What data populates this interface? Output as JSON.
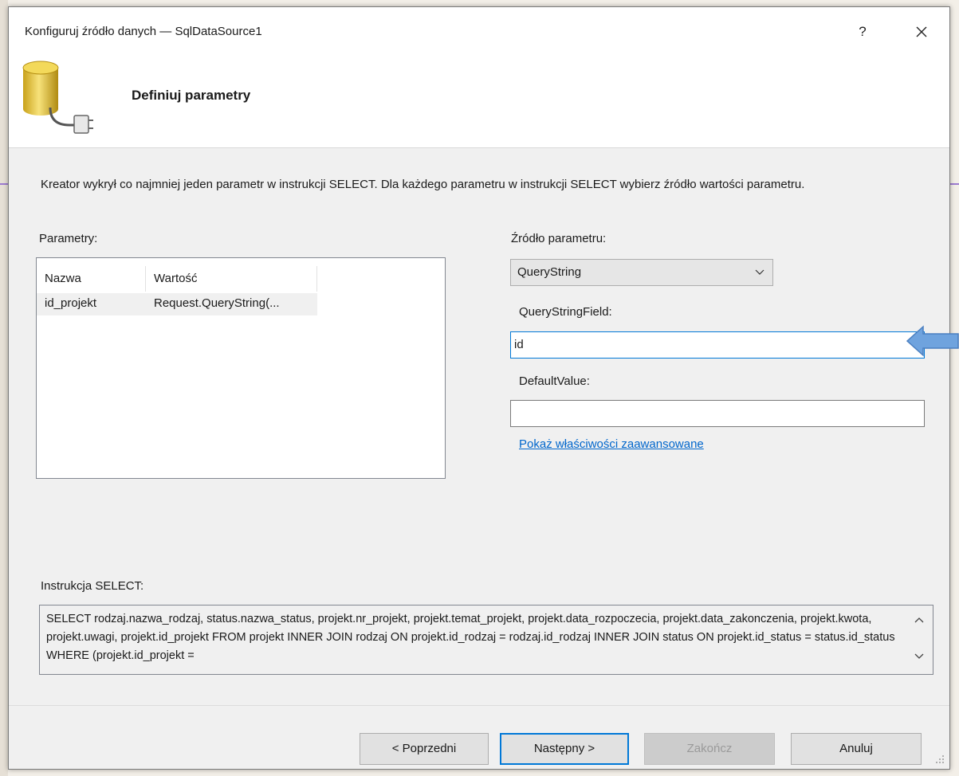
{
  "window": {
    "title": "Konfiguruj źródło danych — SqlDataSource1",
    "help_label": "?",
    "close_icon": "close-icon"
  },
  "header": {
    "title": "Definiuj parametry",
    "icon": "database-connector-icon"
  },
  "intro_text": "Kreator wykrył co najmniej jeden parametr w instrukcji SELECT. Dla każdego parametru w instrukcji SELECT wybierz źródło wartości parametru.",
  "parameters": {
    "label": "Parametry:",
    "columns": [
      "Nazwa",
      "Wartość"
    ],
    "rows": [
      [
        "id_projekt",
        "Request.QueryString(..."
      ]
    ]
  },
  "source": {
    "label": "Źródło parametru:",
    "selected": "QueryString"
  },
  "querystring_field": {
    "label": "QueryStringField:",
    "value": "id"
  },
  "default_value": {
    "label": "DefaultValue:",
    "value": ""
  },
  "advanced_link": "Pokaż właściwości zaawansowane",
  "select_statement": {
    "label": "Instrukcja SELECT:",
    "text": "SELECT rodzaj.nazwa_rodzaj, status.nazwa_status, projekt.nr_projekt, projekt.temat_projekt, projekt.data_rozpoczecia, projekt.data_zakonczenia, projekt.kwota, projekt.uwagi, projekt.id_projekt FROM projekt INNER JOIN rodzaj ON projekt.id_rodzaj = rodzaj.id_rodzaj INNER JOIN status ON projekt.id_status = status.id_status WHERE (projekt.id_projekt ="
  },
  "buttons": {
    "prev": "< Poprzedni",
    "next": "Następny >",
    "finish": "Zakończ",
    "cancel": "Anuluj"
  },
  "colors": {
    "accent": "#0078d7",
    "link": "#0066cc",
    "callout_arrow": "#6fa3de"
  }
}
